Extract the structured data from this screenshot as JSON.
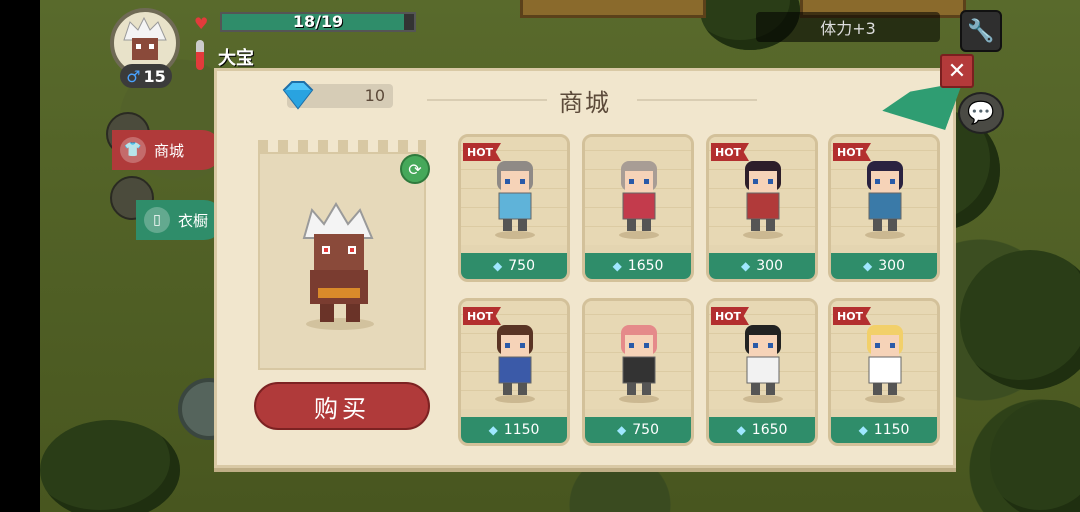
{
  "hud": {
    "hp_text": "18/19",
    "hp_fraction": 0.947,
    "player_name": "大宝",
    "level": "15",
    "stamina": "体力+3"
  },
  "panel": {
    "title": "商城",
    "gems": "10",
    "buy_label": "购买"
  },
  "tabs": [
    {
      "label": "商城"
    },
    {
      "label": "衣橱"
    }
  ],
  "items": [
    {
      "price": "750",
      "hot": "HOT",
      "hair": "#8f8a86",
      "outfit": "#5fb3d9"
    },
    {
      "price": "1650",
      "hot": "",
      "hair": "#a89d95",
      "outfit": "#c33b4c"
    },
    {
      "price": "300",
      "hot": "HOT",
      "hair": "#2d1e2a",
      "outfit": "#b13a3a"
    },
    {
      "price": "300",
      "hot": "HOT",
      "hair": "#2a2240",
      "outfit": "#3a7aa8"
    },
    {
      "price": "1150",
      "hot": "HOT",
      "hair": "#5a3424",
      "outfit": "#3b5aa8"
    },
    {
      "price": "750",
      "hot": "",
      "hair": "#e58a8a",
      "outfit": "#333333"
    },
    {
      "price": "1650",
      "hot": "HOT",
      "hair": "#222222",
      "outfit": "#f2f2f2"
    },
    {
      "price": "1150",
      "hot": "HOT",
      "hair": "#f2d06a",
      "outfit": "#ffffff"
    }
  ]
}
